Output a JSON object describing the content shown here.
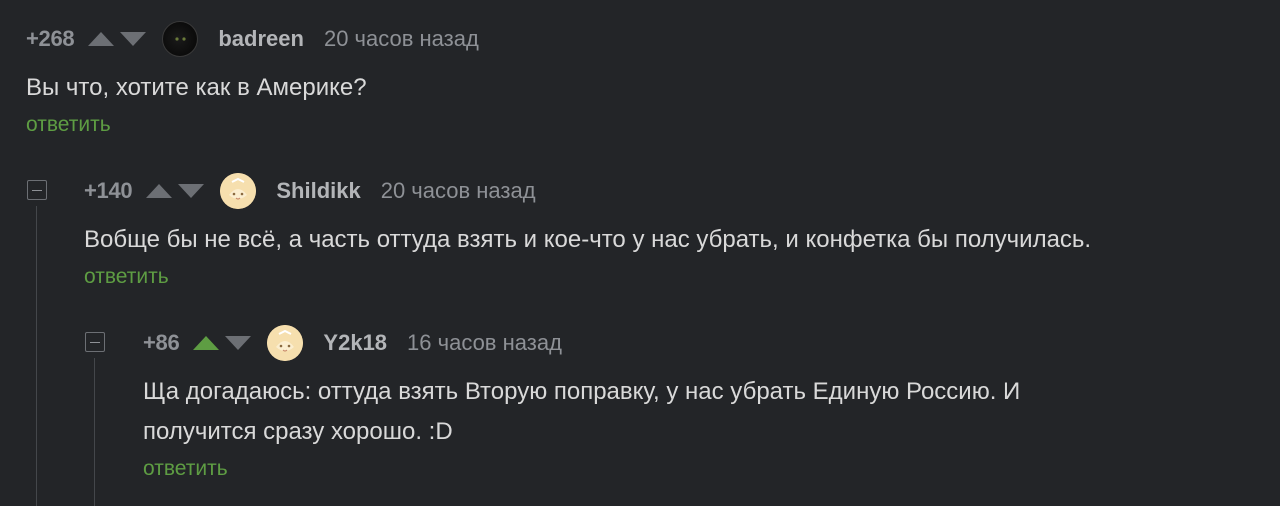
{
  "comments": [
    {
      "rating": "+268",
      "username": "badreen",
      "time": "20 часов назад",
      "text": "Вы что, хотите как в Америке?",
      "reply_label": "ответить"
    },
    {
      "rating": "+140",
      "username": "Shildikk",
      "time": "20 часов назад",
      "text": "Вобще бы не всё, а часть оттуда взять и кое-что у нас убрать, и конфетка бы получилась.",
      "reply_label": "ответить"
    },
    {
      "rating": "+86",
      "username": "Y2k18",
      "time": "16 часов назад",
      "text_line1": "Ща догадаюсь: оттуда взять Вторую поправку, у нас убрать Единую Россию. И",
      "text_line2": "получится сразу хорошо. :D",
      "reply_label": "ответить"
    }
  ],
  "colors": {
    "background": "#232528",
    "accent_green": "#5e9d43",
    "muted": "#8e9196"
  },
  "icons": [
    "upvote-icon",
    "downvote-icon",
    "collapse-icon",
    "avatar"
  ]
}
